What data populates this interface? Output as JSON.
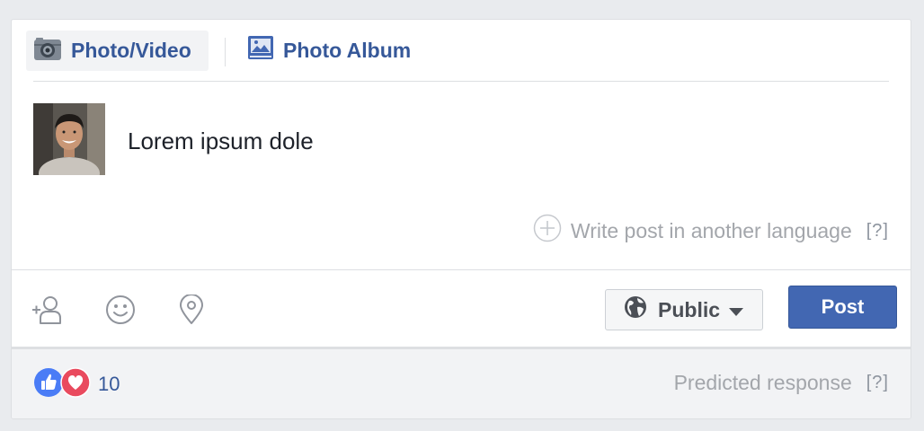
{
  "tabs": {
    "photo_video": "Photo/Video",
    "photo_album": "Photo Album"
  },
  "composer": {
    "text": "Lorem ipsum dole",
    "language_link": "Write post in another language",
    "help": "[?]"
  },
  "toolbar": {
    "privacy_label": "Public",
    "post_label": "Post"
  },
  "prediction": {
    "reaction_count": "10",
    "label": "Predicted response",
    "help": "[?]"
  },
  "colors": {
    "brand_blue": "#4267b2",
    "link_blue": "#365899",
    "like_blue": "#4a7cf6",
    "love_red": "#e94a5e"
  }
}
